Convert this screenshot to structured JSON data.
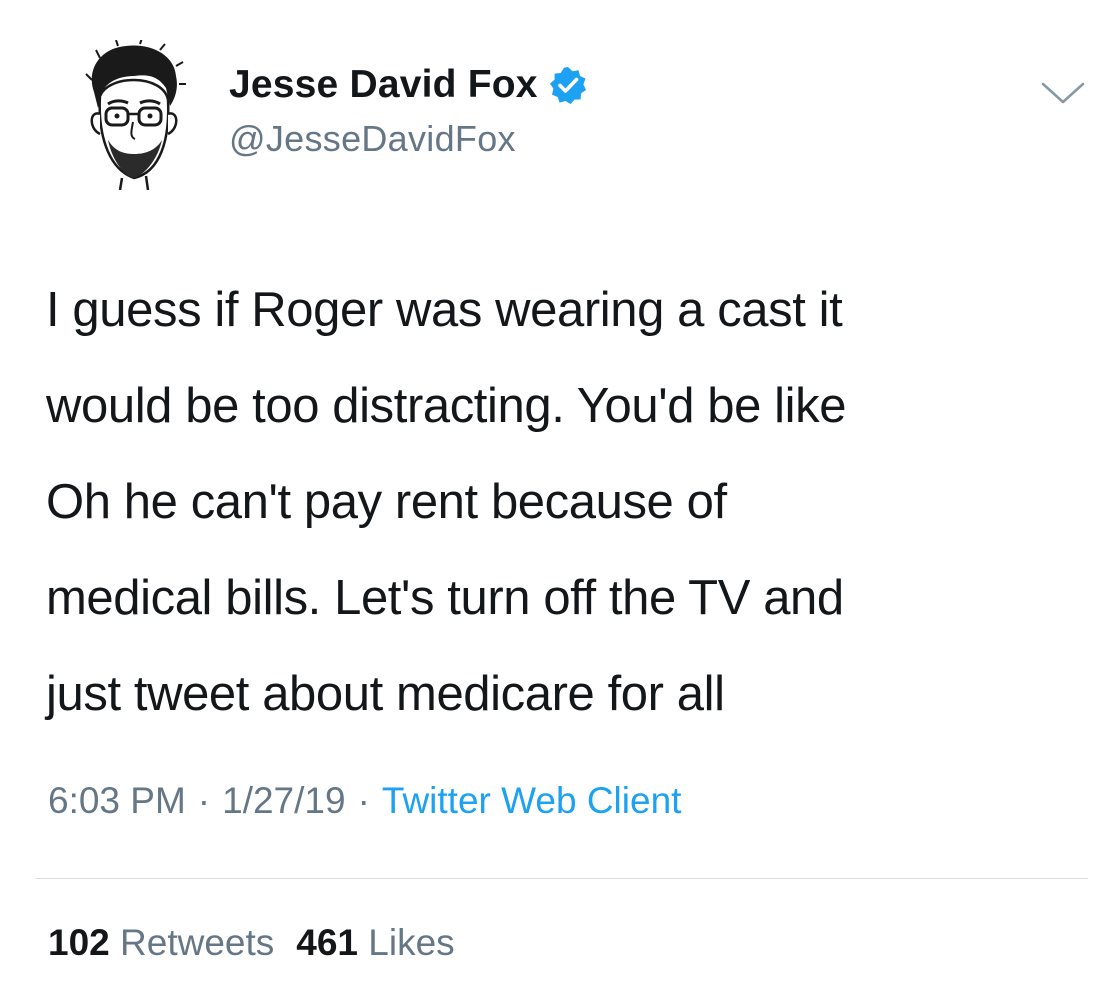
{
  "author": {
    "display_name": "Jesse David Fox",
    "handle": "@JesseDavidFox",
    "verified": true,
    "avatar_icon": "cartoon-portrait-avatar",
    "verified_icon": "verified-badge-icon"
  },
  "tweet": {
    "lines": [
      "I guess if Roger was wearing a cast it",
      "would be too distracting. You'd be like",
      "Oh he can't pay rent because of",
      "medical bills. Let's turn off the TV and",
      "just tweet about medicare for all"
    ]
  },
  "meta": {
    "time": "6:03 PM",
    "separator": "·",
    "date": "1/27/19",
    "source": "Twitter Web Client"
  },
  "stats": {
    "retweets_count": "102",
    "retweets_label": "Retweets",
    "likes_count": "461",
    "likes_label": "Likes"
  },
  "colors": {
    "text": "#14171a",
    "secondary": "#657786",
    "link": "#1da1f2",
    "divider": "#d5dbe0",
    "verified": "#1da1f2"
  },
  "icons": {
    "menu": "chevron-down-icon"
  }
}
